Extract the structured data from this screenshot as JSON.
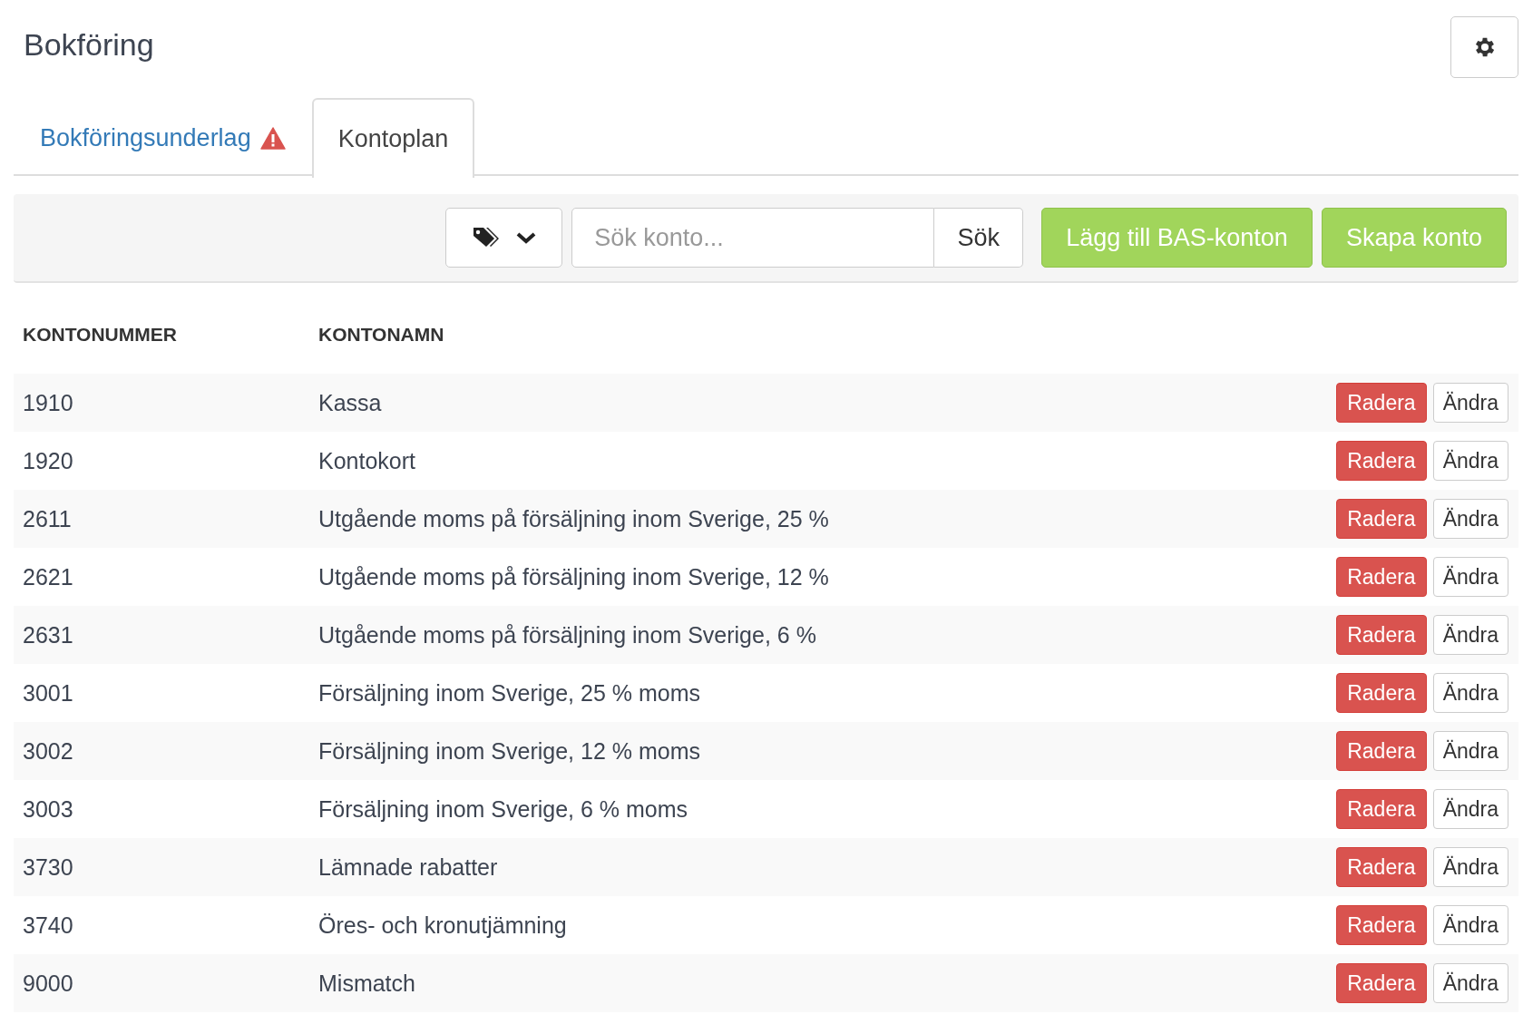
{
  "page": {
    "title": "Bokföring"
  },
  "tabs": [
    {
      "label": "Bokföringsunderlag",
      "selected": false,
      "warning": true
    },
    {
      "label": "Kontoplan",
      "selected": true,
      "warning": false
    }
  ],
  "toolbar": {
    "search": {
      "placeholder": "Sök konto..."
    },
    "search_button": "Sök",
    "buttons": [
      "Lägg till BAS-konton",
      "Skapa konto"
    ]
  },
  "table": {
    "columns": [
      "KONTONUMMER",
      "KONTONAMN"
    ],
    "rows": [
      {
        "number": "1910",
        "name": "Kassa",
        "delete": "Radera",
        "edit": "Ändra"
      },
      {
        "number": "1920",
        "name": "Kontokort",
        "delete": "Radera",
        "edit": "Ändra"
      },
      {
        "number": "2611",
        "name": "Utgående moms på försäljning inom Sverige, 25 %",
        "delete": "Radera",
        "edit": "Ändra"
      },
      {
        "number": "2621",
        "name": "Utgående moms på försäljning inom Sverige, 12 %",
        "delete": "Radera",
        "edit": "Ändra"
      },
      {
        "number": "2631",
        "name": "Utgående moms på försäljning inom Sverige, 6 %",
        "delete": "Radera",
        "edit": "Ändra"
      },
      {
        "number": "3001",
        "name": "Försäljning inom Sverige, 25 % moms",
        "delete": "Radera",
        "edit": "Ändra"
      },
      {
        "number": "3002",
        "name": "Försäljning inom Sverige, 12 % moms",
        "delete": "Radera",
        "edit": "Ändra"
      },
      {
        "number": "3003",
        "name": "Försäljning inom Sverige, 6 % moms",
        "delete": "Radera",
        "edit": "Ändra"
      },
      {
        "number": "3730",
        "name": "Lämnade rabatter",
        "delete": "Radera",
        "edit": "Ändra"
      },
      {
        "number": "3740",
        "name": "Öres- och kronutjämning",
        "delete": "Radera",
        "edit": "Ändra"
      },
      {
        "number": "9000",
        "name": "Mismatch",
        "delete": "Radera",
        "edit": "Ändra"
      }
    ]
  }
}
